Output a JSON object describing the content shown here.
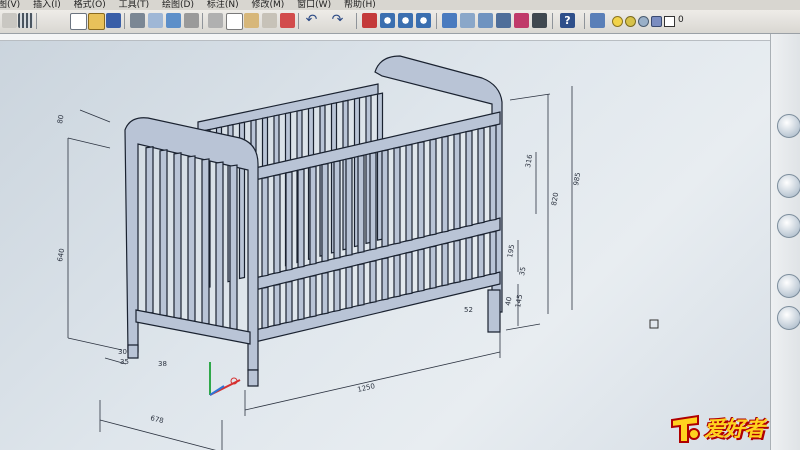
{
  "menu": {
    "items": [
      "图(V)",
      "插入(I)",
      "格式(O)",
      "工具(T)",
      "绘图(D)",
      "标注(N)",
      "修改(M)",
      "窗口(W)",
      "帮助(H)"
    ]
  },
  "toolbar": {
    "icons": [
      "menu-arrow",
      "grid",
      "new",
      "open",
      "save",
      "print",
      "preview",
      "publish",
      "cut",
      "copy",
      "paste",
      "match-properties",
      "undo",
      "redo",
      "pan",
      "zoom-realtime",
      "zoom-window",
      "zoom-previous",
      "properties",
      "design-center",
      "tool-palettes",
      "sheet-set",
      "markup",
      "calculator",
      "help",
      "layers",
      "layer-state"
    ],
    "layer_value": "0"
  },
  "drawing": {
    "dims": {
      "top_left_80": "80",
      "left_640": "640",
      "bottom_left_30": "30",
      "bottom_left_35": "35",
      "bottom_38": "38",
      "bottom_678": "678",
      "bottom_1250": "1250",
      "right_316": "316",
      "right_195": "195",
      "right_35": "35",
      "right_145": "145",
      "right_40": "40",
      "right_820": "820",
      "right_985": "985",
      "small_52": "52"
    }
  },
  "watermark": {
    "text": "爱好者"
  },
  "colors": {
    "crib_fill": "#b9c4d6",
    "crib_edge": "#1a2230",
    "dim_line": "#2c3340",
    "axis_x": "#d63030",
    "axis_y": "#2fa84a",
    "axis_z": "#2f74d6"
  }
}
